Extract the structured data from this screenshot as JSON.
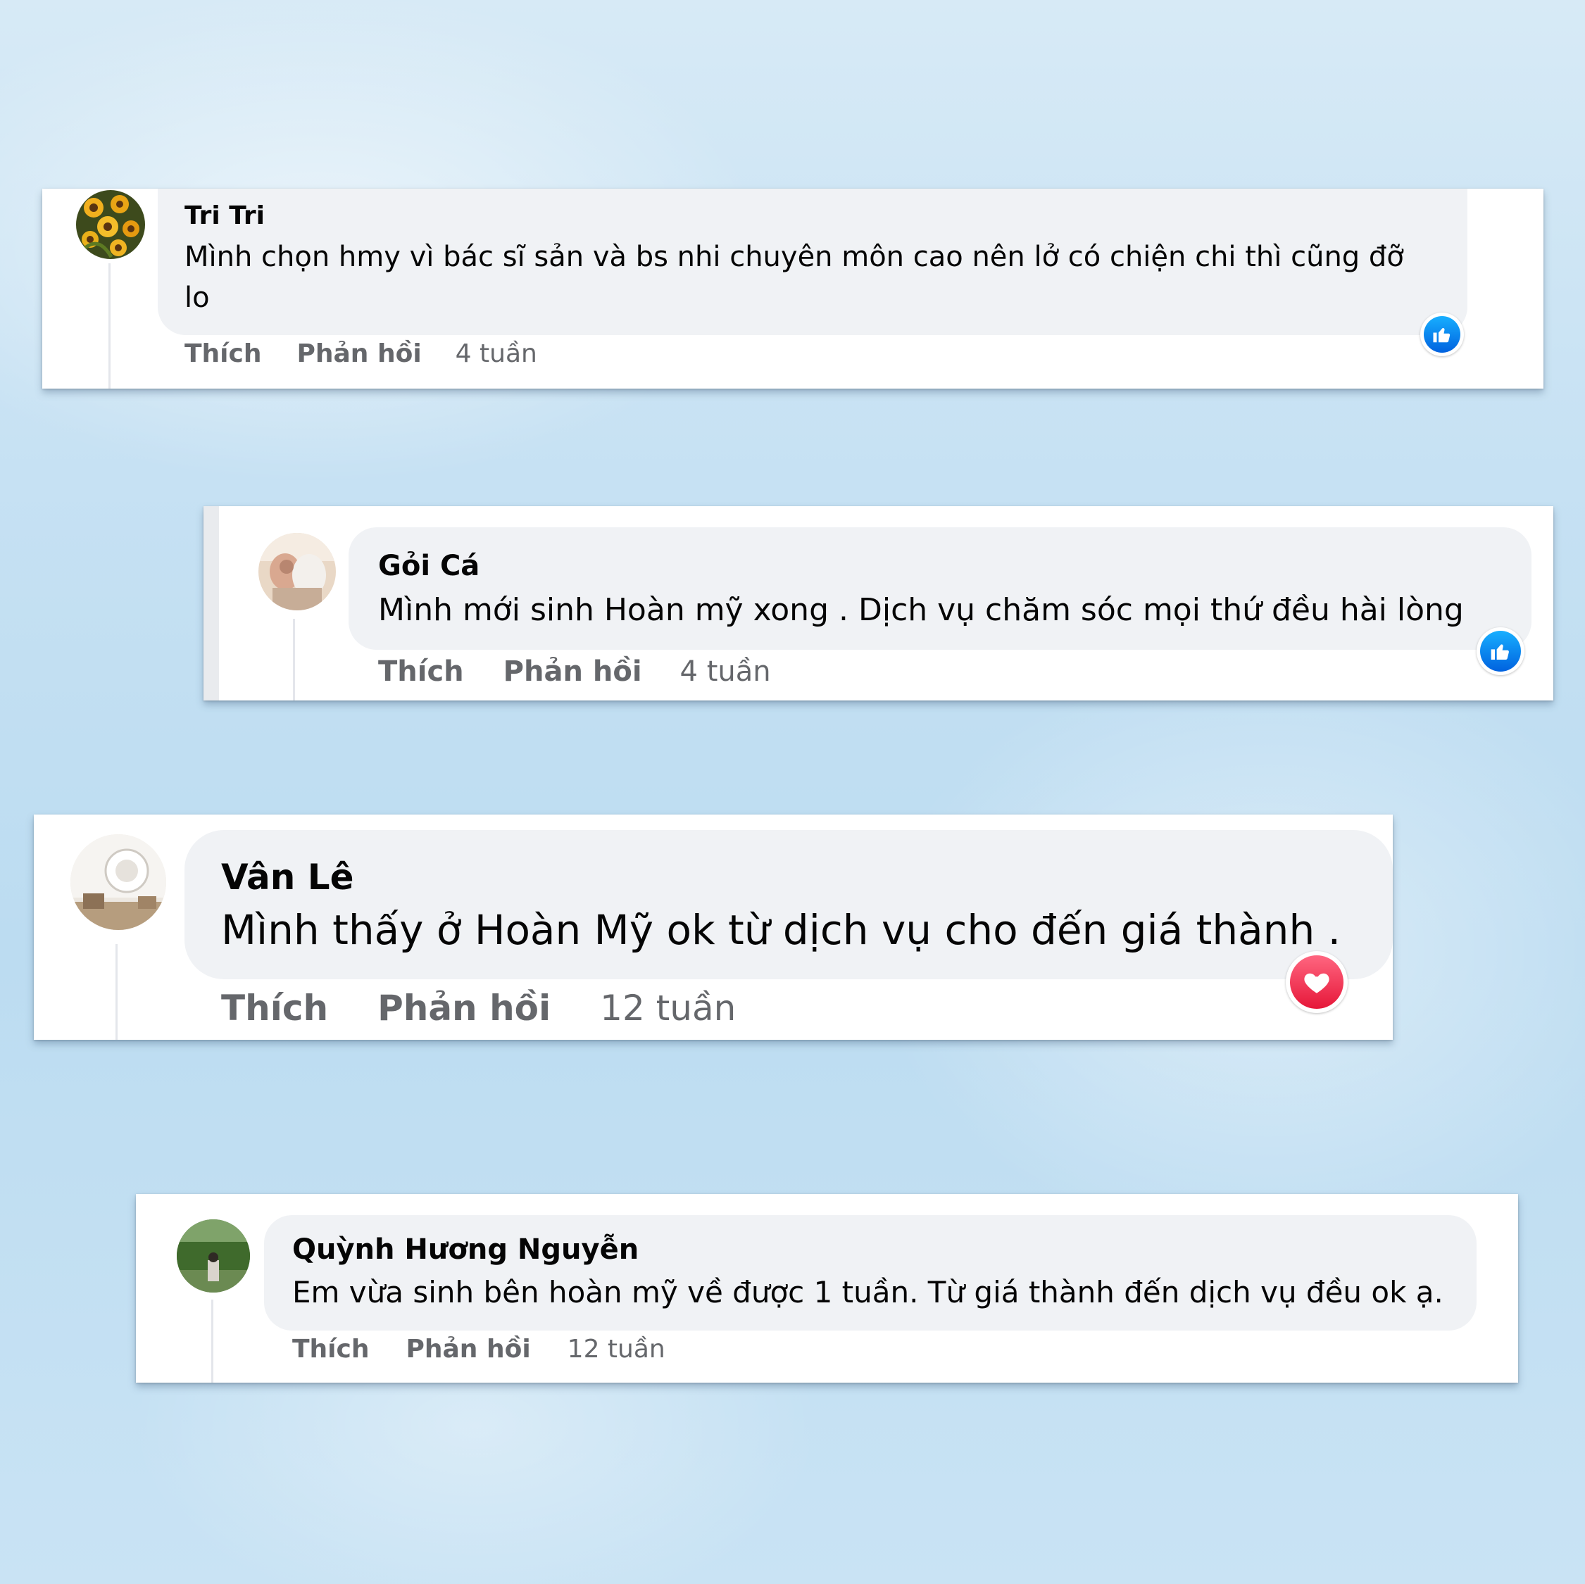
{
  "colors": {
    "like_blue": "#0866ff",
    "love_red": "#f33e58",
    "bubble_gray": "#f0f2f5",
    "meta_gray": "#65676b"
  },
  "comments": [
    {
      "author": "Tri Tri",
      "text": "Mình chọn hmy vì bác sĩ sản và bs nhi chuyên môn cao nên lở có chiện chi thì cũng đỡ lo",
      "like_label": "Thích",
      "reply_label": "Phản hồi",
      "time": "4 tuần",
      "reaction": "like-icon"
    },
    {
      "author": "Gỏi Cá",
      "text": "Mình mới sinh Hoàn mỹ xong . Dịch vụ chăm sóc mọi thứ đều hài lòng",
      "like_label": "Thích",
      "reply_label": "Phản hồi",
      "time": "4 tuần",
      "reaction": "like-icon"
    },
    {
      "author": "Vân Lê",
      "text": "Mình thấy ở Hoàn Mỹ ok từ dịch vụ cho đến giá thành .",
      "like_label": "Thích",
      "reply_label": "Phản hồi",
      "time": "12 tuần",
      "reaction": "love-icon"
    },
    {
      "author": "Quỳnh Hương Nguyễn",
      "text": "Em vừa sinh bên hoàn mỹ về được 1 tuần. Từ giá thành đến dịch vụ đều ok ạ.",
      "like_label": "Thích",
      "reply_label": "Phản hồi",
      "time": "12 tuần",
      "reaction": "like-icon"
    }
  ]
}
